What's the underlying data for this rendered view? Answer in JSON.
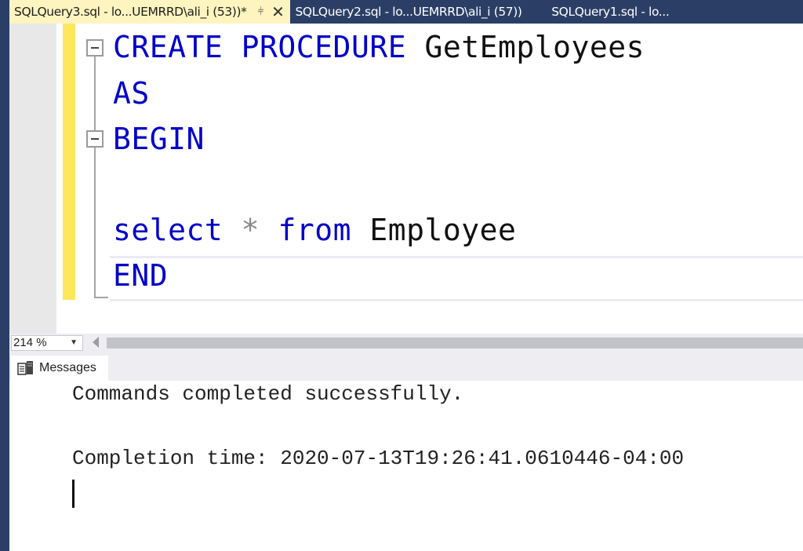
{
  "tabs": [
    {
      "label": "SQLQuery3.sql - lo...UEMRRD\\ali_i (53))*",
      "active": true,
      "pin_icon": "pin-icon",
      "close_icon": "close-icon"
    },
    {
      "label": "SQLQuery2.sql - lo...UEMRRD\\ali_i (57))",
      "active": false
    },
    {
      "label": "SQLQuery1.sql - lo...",
      "active": false
    }
  ],
  "editor": {
    "lines": [
      {
        "tokens": [
          {
            "t": "CREATE",
            "c": "kw"
          },
          {
            "t": " ",
            "c": "id"
          },
          {
            "t": "PROCEDURE",
            "c": "kw"
          },
          {
            "t": " GetEmployees",
            "c": "id"
          }
        ]
      },
      {
        "tokens": [
          {
            "t": "AS",
            "c": "kw"
          }
        ]
      },
      {
        "tokens": [
          {
            "t": "BEGIN",
            "c": "kw"
          }
        ]
      },
      {
        "tokens": []
      },
      {
        "tokens": [
          {
            "t": "select",
            "c": "kw"
          },
          {
            "t": " ",
            "c": "id"
          },
          {
            "t": "*",
            "c": "op"
          },
          {
            "t": " ",
            "c": "id"
          },
          {
            "t": "from",
            "c": "kw"
          },
          {
            "t": " Employee",
            "c": "id"
          }
        ]
      },
      {
        "tokens": [
          {
            "t": "END",
            "c": "kw"
          }
        ]
      }
    ],
    "keyword_color": "#0000c8",
    "identifier_color": "#111111",
    "operator_color": "#888888"
  },
  "zoom": {
    "value": "214 %"
  },
  "results": {
    "tab_label": "Messages",
    "messages": [
      "Commands completed successfully.",
      "",
      "Completion time: 2020-07-13T19:26:41.0610446-04:00"
    ]
  },
  "colors": {
    "frame": "#2b3f66",
    "active_tab": "#fdf4bf",
    "change_bar": "#fce85a"
  }
}
